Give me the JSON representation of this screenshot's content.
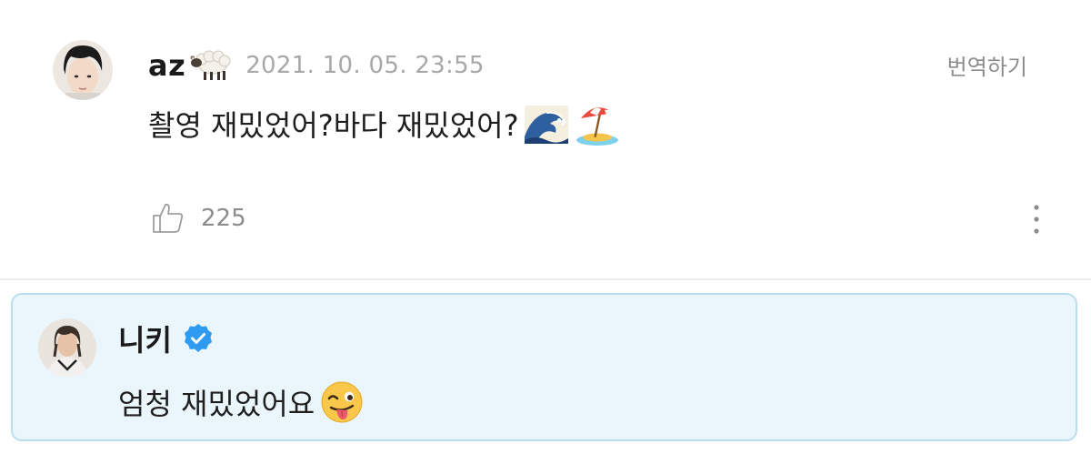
{
  "comment": {
    "author": "az",
    "author_emoji": "sheep-emoji",
    "timestamp": "2021. 10. 05. 23:55",
    "translate_label": "번역하기",
    "text": "촬영 재밌었어?바다 재밌었어?",
    "trailing_emojis": [
      "water-wave-emoji",
      "beach-umbrella-island-emoji"
    ],
    "like_count": "225"
  },
  "reply": {
    "author": "니키",
    "verified": true,
    "text": "엄청 재밌었어요",
    "trailing_emoji": "winking-tongue-emoji"
  },
  "colors": {
    "reply_background": "#ebf6fc",
    "reply_border": "#b9dfee",
    "verified_blue": "#2f9bf0",
    "timestamp_gray": "#a8a8a8"
  }
}
